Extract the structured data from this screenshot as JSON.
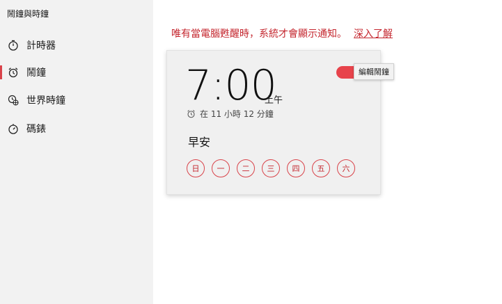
{
  "app": {
    "title": "鬧鐘與時鐘"
  },
  "sidebar": {
    "items": [
      {
        "label": "計時器",
        "icon": "timer-icon",
        "active": false
      },
      {
        "label": "鬧鐘",
        "icon": "alarm-clock-icon",
        "active": true
      },
      {
        "label": "世界時鐘",
        "icon": "world-clock-icon",
        "active": false
      },
      {
        "label": "碼錶",
        "icon": "stopwatch-icon",
        "active": false
      }
    ]
  },
  "main": {
    "notice": "唯有當電腦甦醒時，系統才會顯示通知。",
    "learn_more": "深入了解"
  },
  "alarm": {
    "time": "7:00",
    "ampm": "上午",
    "countdown": "在 11 小時 12 分鐘",
    "name": "早安",
    "enabled": true,
    "days": [
      "日",
      "一",
      "二",
      "三",
      "四",
      "五",
      "六"
    ]
  },
  "tooltip": {
    "text": "編輯鬧鐘"
  },
  "colors": {
    "accent": "#e7434b",
    "accent_text": "#c4262e"
  }
}
